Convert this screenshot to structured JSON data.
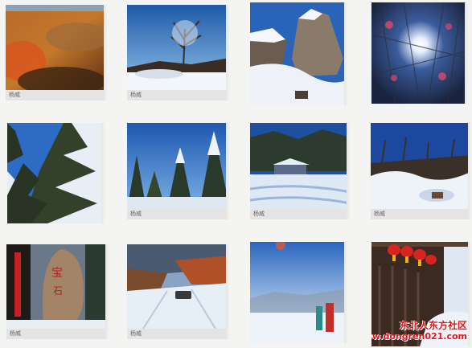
{
  "gallery": {
    "thumbnails": [
      {
        "caption": "杨威",
        "scene": "autumn-forest-hillside"
      },
      {
        "caption": "杨威",
        "scene": "snowy-bare-tree-blue-sky"
      },
      {
        "caption": "",
        "scene": "snow-capped-boulders"
      },
      {
        "caption": "",
        "scene": "sun-through-frosted-branches"
      },
      {
        "caption": "",
        "scene": "snow-laden-pine-trees"
      },
      {
        "caption": "杨威",
        "scene": "snowy-conifer-forest"
      },
      {
        "caption": "杨威",
        "scene": "cabin-in-snow-valley"
      },
      {
        "caption": "杨威",
        "scene": "snow-drifts-hillside"
      },
      {
        "caption": "杨威",
        "scene": "carved-stone-roadside"
      },
      {
        "caption": "杨威",
        "scene": "car-on-snowy-road"
      },
      {
        "caption": "",
        "scene": "hazy-sky-visitors-in-snow"
      },
      {
        "caption": "",
        "scene": "red-lanterns-wooden-eaves"
      }
    ]
  },
  "watermark": {
    "line1": "东北人东方社区",
    "line2": "www.dongren021.com",
    "color": "#e1141b"
  }
}
